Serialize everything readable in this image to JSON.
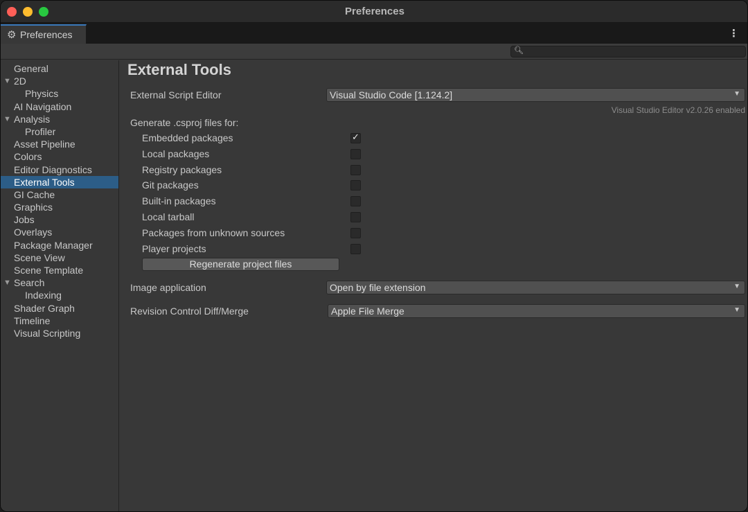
{
  "window": {
    "title": "Preferences"
  },
  "tab": {
    "label": "Preferences",
    "icon": "gear-icon"
  },
  "search": {
    "value": "",
    "placeholder": ""
  },
  "sidebar": {
    "items": [
      {
        "label": "General",
        "level": 0
      },
      {
        "label": "2D",
        "level": 0,
        "expandable": true
      },
      {
        "label": "Physics",
        "level": 1
      },
      {
        "label": "AI Navigation",
        "level": 0
      },
      {
        "label": "Analysis",
        "level": 0,
        "expandable": true
      },
      {
        "label": "Profiler",
        "level": 1
      },
      {
        "label": "Asset Pipeline",
        "level": 0
      },
      {
        "label": "Colors",
        "level": 0
      },
      {
        "label": "Editor Diagnostics",
        "level": 0
      },
      {
        "label": "External Tools",
        "level": 0,
        "selected": true
      },
      {
        "label": "GI Cache",
        "level": 0
      },
      {
        "label": "Graphics",
        "level": 0
      },
      {
        "label": "Jobs",
        "level": 0
      },
      {
        "label": "Overlays",
        "level": 0
      },
      {
        "label": "Package Manager",
        "level": 0
      },
      {
        "label": "Scene View",
        "level": 0
      },
      {
        "label": "Scene Template",
        "level": 0
      },
      {
        "label": "Search",
        "level": 0,
        "expandable": true
      },
      {
        "label": "Indexing",
        "level": 1
      },
      {
        "label": "Shader Graph",
        "level": 0
      },
      {
        "label": "Timeline",
        "level": 0
      },
      {
        "label": "Visual Scripting",
        "level": 0
      }
    ]
  },
  "main": {
    "title": "External Tools",
    "script_editor": {
      "label": "External Script Editor",
      "value": "Visual Studio Code [1.124.2]",
      "hint": "Visual Studio Editor v2.0.26 enabled"
    },
    "csproj": {
      "heading": "Generate .csproj files for:",
      "options": [
        {
          "label": "Embedded packages",
          "checked": true
        },
        {
          "label": "Local packages",
          "checked": false
        },
        {
          "label": "Registry packages",
          "checked": false
        },
        {
          "label": "Git packages",
          "checked": false
        },
        {
          "label": "Built-in packages",
          "checked": false
        },
        {
          "label": "Local tarball",
          "checked": false
        },
        {
          "label": "Packages from unknown sources",
          "checked": false
        },
        {
          "label": "Player projects",
          "checked": false
        }
      ],
      "regenerate_label": "Regenerate project files"
    },
    "image_app": {
      "label": "Image application",
      "value": "Open by file extension"
    },
    "diff_merge": {
      "label": "Revision Control Diff/Merge",
      "value": "Apple File Merge"
    }
  },
  "colors": {
    "selection": "#2c5d87",
    "tab_accent": "#3a79bb",
    "close": "#fe5f57",
    "minimize": "#febc2e",
    "maximize": "#28c840"
  }
}
